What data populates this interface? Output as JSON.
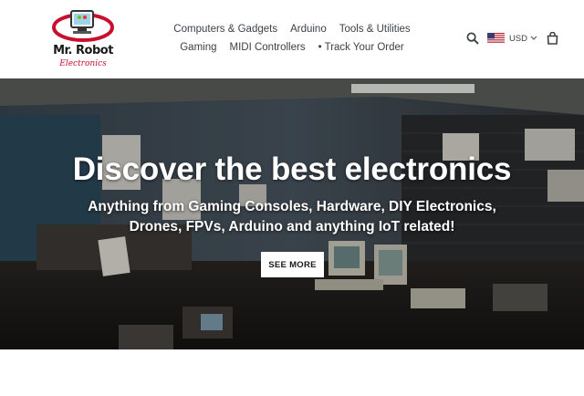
{
  "brand": {
    "name_line1": "Mr. Robot",
    "name_line2": "Electronics",
    "colors": {
      "red": "#c8102e",
      "dark": "#1a1a1a"
    }
  },
  "nav": {
    "row1": [
      "Computers & Gadgets",
      "Arduino",
      "Tools & Utilities"
    ],
    "row2": [
      "Gaming",
      "MIDI Controllers",
      "• Track Your Order"
    ]
  },
  "tools": {
    "search_icon": "search-icon",
    "flag_icon": "us-flag-icon",
    "currency": "USD",
    "chevron_icon": "chevron-down-icon",
    "cart_icon": "cart-icon"
  },
  "hero": {
    "title": "Discover the best electronics",
    "subtitle": "Anything from Gaming Consoles, Hardware, DIY Electronics, Drones, FPVs, Arduino and anything IoT related!",
    "button_label": "SEE MORE"
  }
}
